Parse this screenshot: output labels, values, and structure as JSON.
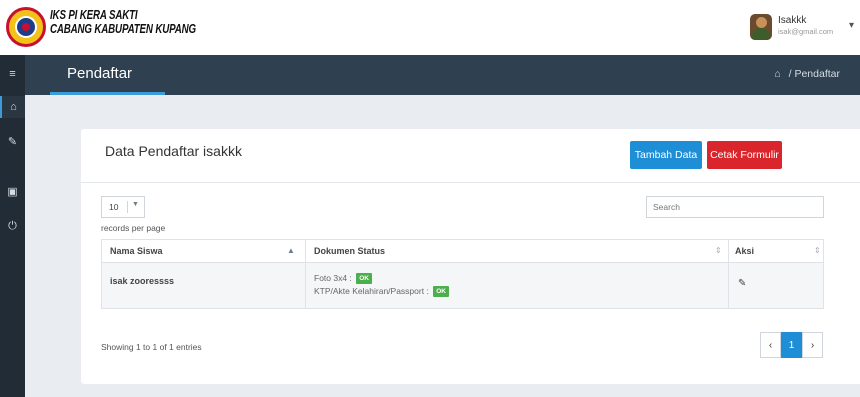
{
  "header": {
    "brand_line1": "IKS PI KERA SAKTI",
    "brand_line2": "CABANG KABUPATEN KUPANG",
    "user_name": "Isakkk",
    "user_email": "isak@gmail.com"
  },
  "sidebar": {
    "items": [
      {
        "icon": "menu-icon",
        "glyph": "≡"
      },
      {
        "icon": "home-icon",
        "glyph": "⌂"
      },
      {
        "icon": "edit-icon",
        "glyph": "✎"
      },
      {
        "icon": "money-icon",
        "glyph": "▣"
      },
      {
        "icon": "power-icon",
        "glyph": "⏻"
      }
    ]
  },
  "pagebar": {
    "title": "Pendaftar",
    "breadcrumb_sep": "/",
    "breadcrumb_current": "Pendaftar"
  },
  "card": {
    "title": "Data Pendaftar isakkk",
    "btn_add": "Tambah Data",
    "btn_print": "Cetak Formulir",
    "page_length": "10",
    "page_length_label": "records per page",
    "search_placeholder": "Search"
  },
  "table": {
    "headers": [
      "Nama Siswa",
      "Dokumen Status",
      "Aksi"
    ],
    "rows": [
      {
        "nama": "isak zooressss",
        "doc1_label": "Foto 3x4 :",
        "doc1_status": "OK",
        "doc2_label": "KTP/Akte Kelahiran/Passport :",
        "doc2_status": "OK"
      }
    ]
  },
  "footer": {
    "info": "Showing 1 to 1 of 1 entries",
    "prev": "‹",
    "page": "1",
    "next": "›"
  },
  "colors": {
    "accent_blue": "#1e8ed7",
    "danger_red": "#d9252b",
    "ok_green": "#4cae4c",
    "sidebar_dark": "#222c37",
    "pagebar_dark": "#2f4050"
  }
}
